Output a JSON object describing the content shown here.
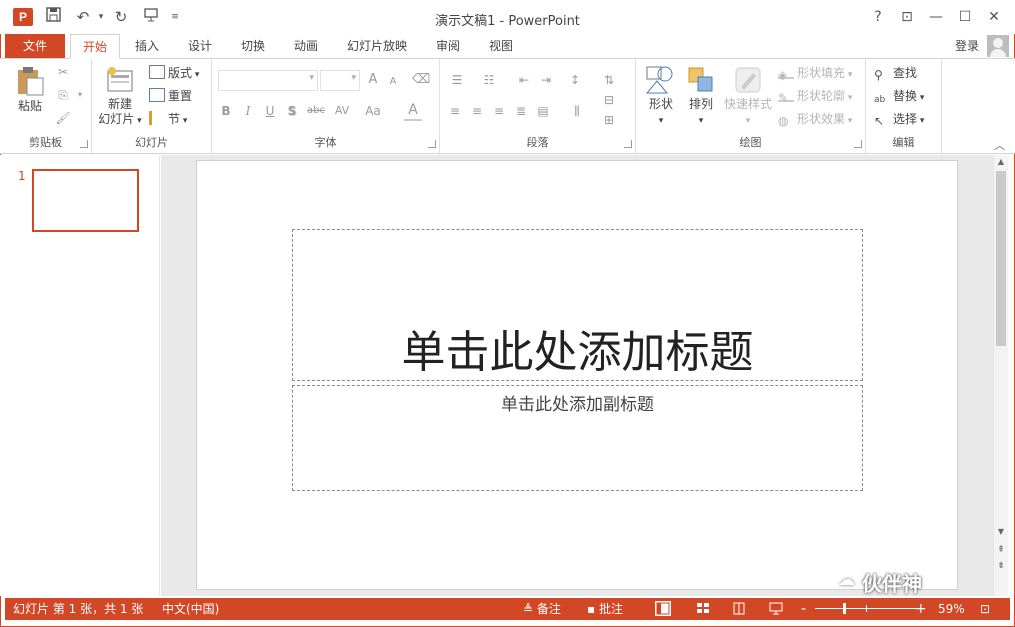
{
  "titlebar": {
    "app_icon_letter": "P",
    "window_title": "演示文稿1 - PowerPoint",
    "qat": [
      "save-icon",
      "undo-icon",
      "redo-icon",
      "start-slideshow-icon",
      "customize-qat-icon"
    ],
    "window_buttons": {
      "help": "?",
      "restore_ribbon": "⊡",
      "minimize": "—",
      "maximize": "☐",
      "close": "✕"
    }
  },
  "tabs": {
    "file": "文件",
    "items": [
      "开始",
      "插入",
      "设计",
      "切换",
      "动画",
      "幻灯片放映",
      "审阅",
      "视图"
    ],
    "active": "开始",
    "login": "登录"
  },
  "ribbon": {
    "clipboard": {
      "label": "剪贴板",
      "paste": "粘贴"
    },
    "slides": {
      "label": "幻灯片",
      "new_slide_line1": "新建",
      "new_slide_line2": "幻灯片",
      "layout": "版式",
      "reset": "重置",
      "section": "节"
    },
    "font": {
      "label": "字体",
      "bold": "B",
      "italic": "I",
      "underline": "U",
      "shadow": "S",
      "strike": "abc",
      "spacing": "AV",
      "case": "Aa",
      "color": "A",
      "grow": "A",
      "shrink": "A"
    },
    "paragraph": {
      "label": "段落"
    },
    "drawing": {
      "label": "绘图",
      "shapes": "形状",
      "arrange": "排列",
      "quick_styles": "快速样式",
      "fill": "形状填充",
      "outline": "形状轮廓",
      "effects": "形状效果"
    },
    "editing": {
      "label": "编辑",
      "find": "查找",
      "replace": "替换",
      "select": "选择"
    }
  },
  "thumbnails": {
    "slide_number": "1"
  },
  "slide": {
    "title_placeholder": "单击此处添加标题",
    "subtitle_placeholder": "单击此处添加副标题"
  },
  "watermark": {
    "text": "伙伴神"
  },
  "statusbar": {
    "slide_info": "幻灯片 第 1 张，共 1 张",
    "language": "中文(中国)",
    "notes": "备注",
    "comments": "批注",
    "zoom": "59%",
    "zoom_minus": "-",
    "zoom_plus": "+"
  },
  "colors": {
    "accent": "#d24726",
    "ribbon_bg": "#ffffff",
    "workspace": "#e9e9e9"
  }
}
